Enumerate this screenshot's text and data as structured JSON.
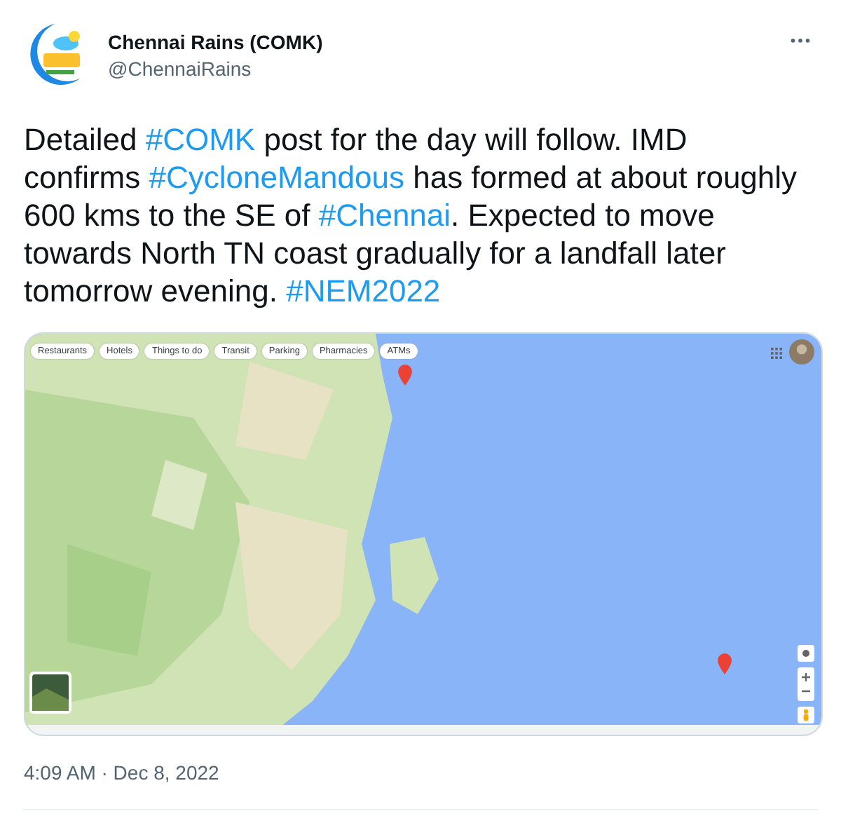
{
  "author": {
    "name": "Chennai Rains (COMK)",
    "handle": "@ChennaiRains"
  },
  "tweet": [
    {
      "kind": "text",
      "text": "Detailed "
    },
    {
      "kind": "hashtag",
      "text": "#COMK"
    },
    {
      "kind": "text",
      "text": " post for the day will follow. IMD confirms "
    },
    {
      "kind": "hashtag",
      "text": "#CycloneMandous"
    },
    {
      "kind": "text",
      "text": " has formed at about roughly 600 kms to the SE of "
    },
    {
      "kind": "hashtag",
      "text": "#Chennai"
    },
    {
      "kind": "text",
      "text": ".  Expected to move towards North TN coast gradually for a landfall later tomorrow evening. "
    },
    {
      "kind": "hashtag",
      "text": "#NEM2022"
    }
  ],
  "map": {
    "kind": "picture",
    "chips": [
      "Restaurants",
      "Hotels",
      "Things to do",
      "Transit",
      "Parking",
      "Pharmacies",
      "ATMs"
    ]
  },
  "timestamp": "4:09 AM · Dec 8, 2022"
}
